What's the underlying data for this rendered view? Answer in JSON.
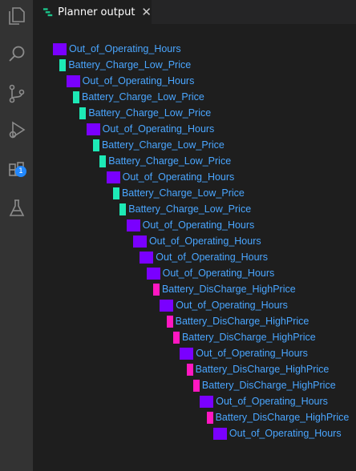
{
  "tab": {
    "title": "Planner output",
    "close_glyph": "✕"
  },
  "activity_bar": {
    "items": [
      {
        "icon": "explorer-icon"
      },
      {
        "icon": "search-icon"
      },
      {
        "icon": "source-control-icon"
      },
      {
        "icon": "run-debug-icon"
      },
      {
        "icon": "extensions-icon",
        "badge": "1"
      },
      {
        "icon": "testing-icon"
      }
    ]
  },
  "colors": {
    "out_of_hours": "#7a00ff",
    "charge_low": "#1de9b6",
    "discharge_high": "#ff17c1",
    "label_text": "#4aa6ff"
  },
  "plan": [
    {
      "action": "Out_of_Operating_Hours",
      "kind": "out_of_hours"
    },
    {
      "action": "Battery_Charge_Low_Price",
      "kind": "charge_low"
    },
    {
      "action": "Out_of_Operating_Hours",
      "kind": "out_of_hours"
    },
    {
      "action": "Battery_Charge_Low_Price",
      "kind": "charge_low"
    },
    {
      "action": "Battery_Charge_Low_Price",
      "kind": "charge_low"
    },
    {
      "action": "Out_of_Operating_Hours",
      "kind": "out_of_hours"
    },
    {
      "action": "Battery_Charge_Low_Price",
      "kind": "charge_low"
    },
    {
      "action": "Battery_Charge_Low_Price",
      "kind": "charge_low"
    },
    {
      "action": "Out_of_Operating_Hours",
      "kind": "out_of_hours"
    },
    {
      "action": "Battery_Charge_Low_Price",
      "kind": "charge_low"
    },
    {
      "action": "Battery_Charge_Low_Price",
      "kind": "charge_low"
    },
    {
      "action": "Out_of_Operating_Hours",
      "kind": "out_of_hours"
    },
    {
      "action": "Out_of_Operating_Hours",
      "kind": "out_of_hours"
    },
    {
      "action": "Out_of_Operating_Hours",
      "kind": "out_of_hours"
    },
    {
      "action": "Out_of_Operating_Hours",
      "kind": "out_of_hours"
    },
    {
      "action": "Battery_DisCharge_HighPrice",
      "kind": "discharge_high"
    },
    {
      "action": "Out_of_Operating_Hours",
      "kind": "out_of_hours"
    },
    {
      "action": "Battery_DisCharge_HighPrice",
      "kind": "discharge_high"
    },
    {
      "action": "Battery_DisCharge_HighPrice",
      "kind": "discharge_high"
    },
    {
      "action": "Out_of_Operating_Hours",
      "kind": "out_of_hours"
    },
    {
      "action": "Battery_DisCharge_HighPrice",
      "kind": "discharge_high"
    },
    {
      "action": "Battery_DisCharge_HighPrice",
      "kind": "discharge_high"
    },
    {
      "action": "Out_of_Operating_Hours",
      "kind": "out_of_hours"
    },
    {
      "action": "Battery_DisCharge_HighPrice",
      "kind": "discharge_high"
    },
    {
      "action": "Out_of_Operating_Hours",
      "kind": "out_of_hours"
    }
  ]
}
